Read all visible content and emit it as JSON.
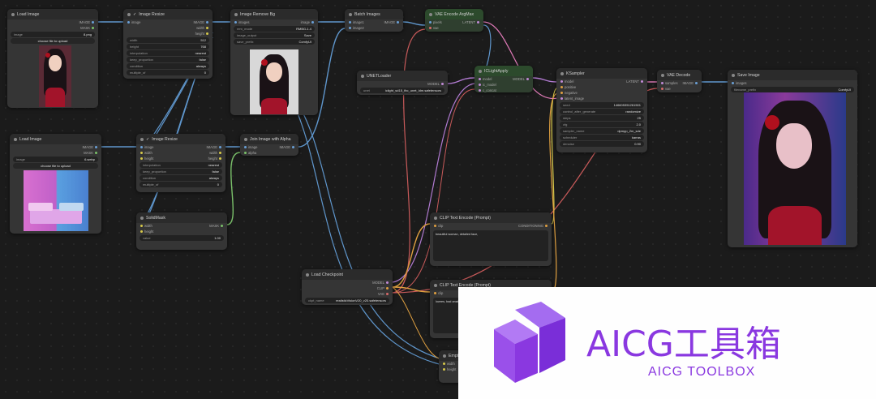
{
  "nodes": {
    "load_image_1": {
      "title": "Load Image",
      "outputs": [
        "IMAGE",
        "MASK"
      ],
      "image_label": "image",
      "image_value": "8.png",
      "upload_label": "choose file to upload"
    },
    "image_resize_1": {
      "title": "Image Resize",
      "input": "image",
      "outputs": [
        "IMAGE",
        "width",
        "height"
      ],
      "widgets": [
        {
          "label": "width",
          "value": "512"
        },
        {
          "label": "height",
          "value": "768"
        },
        {
          "label": "interpolation",
          "value": "nearest"
        },
        {
          "label": "keep_proportion",
          "value": "false"
        },
        {
          "label": "condition",
          "value": "always"
        },
        {
          "label": "multiple_of",
          "value": "0"
        }
      ]
    },
    "image_remove_bg": {
      "title": "Image Remove Bg",
      "input": "images",
      "output": "image",
      "widgets": [
        {
          "label": "rem_mode",
          "value": "RMBG-1.4"
        },
        {
          "label": "image_output",
          "value": "Save"
        },
        {
          "label": "save_prefix",
          "value": "ComfyUI"
        }
      ]
    },
    "batch_images": {
      "title": "Batch Images",
      "inputs": [
        "image1",
        "image2"
      ],
      "output": "IMAGE"
    },
    "vae_encode_argmax": {
      "title": "VAE Encode ArgMax",
      "inputs": [
        "pixels",
        "vae"
      ],
      "output": "LATENT"
    },
    "load_image_2": {
      "title": "Load Image",
      "outputs": [
        "IMAGE",
        "MASK"
      ],
      "image_label": "image",
      "image_value": "6.webp",
      "upload_label": "choose file to upload"
    },
    "image_resize_2": {
      "title": "Image Resize",
      "inputs": [
        "image",
        "width",
        "height"
      ],
      "outputs": [
        "IMAGE",
        "width",
        "height"
      ],
      "widgets": [
        {
          "label": "interpolation",
          "value": "nearest"
        },
        {
          "label": "keep_proportion",
          "value": "false"
        },
        {
          "label": "condition",
          "value": "always"
        },
        {
          "label": "multiple_of",
          "value": "0"
        }
      ]
    },
    "join_image_alpha": {
      "title": "Join Image with Alpha",
      "inputs": [
        "image",
        "alpha"
      ],
      "output": "IMAGE"
    },
    "solid_mask": {
      "title": "SolidMask",
      "inputs": [
        "width",
        "height"
      ],
      "output": "MASK",
      "widgets": [
        {
          "label": "value",
          "value": "1.00"
        }
      ]
    },
    "unet_loader": {
      "title": "UNETLoader",
      "output": "MODEL",
      "widget": {
        "label": "unet",
        "value": "iclight_sd15_fbc_unet_ldm.safetensors"
      }
    },
    "iclight_apply": {
      "title": "ICLightApply",
      "inputs": [
        "model",
        "ic_model",
        "c_concat"
      ],
      "output": "MODEL"
    },
    "ksampler": {
      "title": "KSampler",
      "inputs": [
        "model",
        "positive",
        "negative",
        "latent_image"
      ],
      "output": "LATENT",
      "widgets": [
        {
          "label": "seed",
          "value": "146605351261501"
        },
        {
          "label": "control_after_generate",
          "value": "randomize"
        },
        {
          "label": "steps",
          "value": "25"
        },
        {
          "label": "cfg",
          "value": "2.0"
        },
        {
          "label": "sampler_name",
          "value": "dpmpp_2m_sde"
        },
        {
          "label": "scheduler",
          "value": "karras"
        },
        {
          "label": "denoise",
          "value": "0.90"
        }
      ]
    },
    "vae_decode": {
      "title": "VAE Decode",
      "inputs": [
        "samples",
        "vae"
      ],
      "output": "IMAGE"
    },
    "save_image": {
      "title": "Save Image",
      "input": "images",
      "widget": {
        "label": "filename_prefix",
        "value": "ComfyUI"
      }
    },
    "clip_text_pos": {
      "title": "CLIP Text Encode (Prompt)",
      "input": "clip",
      "output": "CONDITIONING",
      "text": "beautiful woman, detailed face,"
    },
    "clip_text_neg": {
      "title": "CLIP Text Encode (Prompt)",
      "input": "clip",
      "text": "lowres, bad anat"
    },
    "load_checkpoint": {
      "title": "Load Checkpoint",
      "outputs": [
        "MODEL",
        "CLIP",
        "VAE"
      ],
      "widget": {
        "label": "ckpt_name",
        "value": "realisticVisionV20_v20.safetensors"
      }
    },
    "empty_latent": {
      "title": "Empt",
      "inputs": [
        "width",
        "height"
      ]
    }
  },
  "watermark": {
    "title": "AICG工具箱",
    "subtitle": "AICG TOOLBOX",
    "color": "#8a38e0"
  },
  "colors": {
    "canvas": "#1b1b1b",
    "node": "#353535",
    "image_wire": "#6aa0d6",
    "mask_wire": "#7ac06a",
    "model_wire": "#c08ad6",
    "clip_wire": "#e0a040",
    "vae_wire": "#d66a6a",
    "conditioning_wire": "#d6c84a"
  }
}
